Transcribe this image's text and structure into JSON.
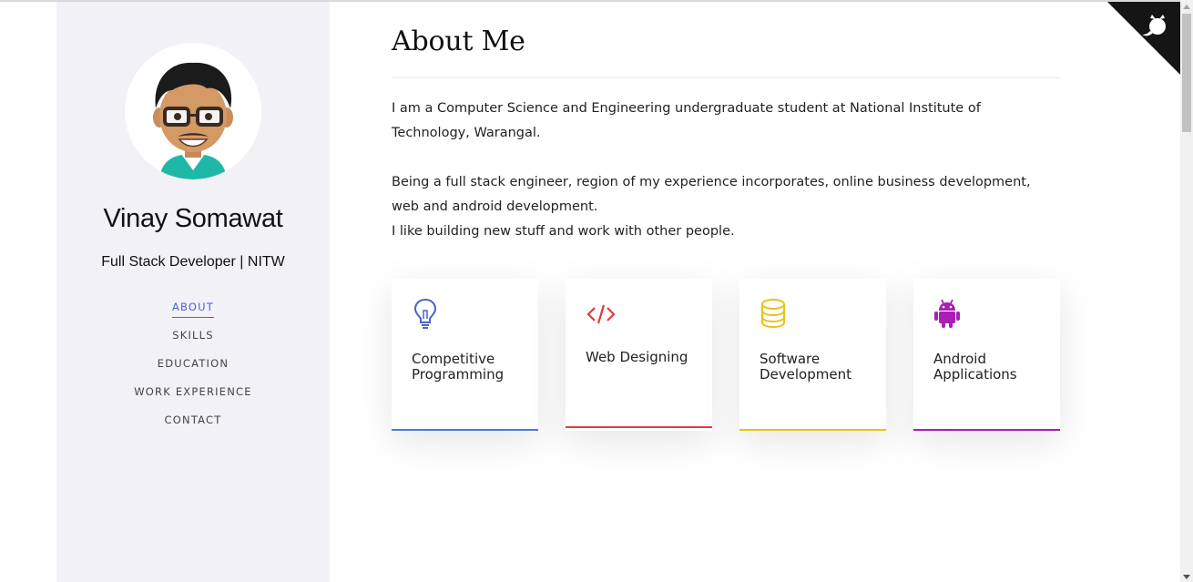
{
  "profile": {
    "name": "Vinay Somawat",
    "role": "Full Stack Developer | NITW"
  },
  "nav": {
    "active": "ABOUT",
    "items": [
      "ABOUT",
      "SKILLS",
      "EDUCATION",
      "WORK EXPERIENCE",
      "CONTACT"
    ]
  },
  "about": {
    "title": "About Me",
    "paragraph1": "I am a Computer Science and Engineering undergraduate student at National Institute of Technology, Warangal.",
    "paragraph2": "Being a full stack engineer, region of my experience incorporates, online business development, web and android development.",
    "paragraph3": "I like building new stuff and work with other people."
  },
  "cards": [
    {
      "label": "Competitive Programming",
      "icon": "lightbulb-icon",
      "color": "#4a64c8"
    },
    {
      "label": "Web Designing",
      "icon": "code-icon",
      "color": "#e23b3b"
    },
    {
      "label": "Software Development",
      "icon": "database-icon",
      "color": "#e8c21a"
    },
    {
      "label": "Android Applications",
      "icon": "android-icon",
      "color": "#a81fb5"
    }
  ],
  "colors": {
    "sidebar_bg": "#f2f1f6",
    "accent": "#4a64c8"
  }
}
